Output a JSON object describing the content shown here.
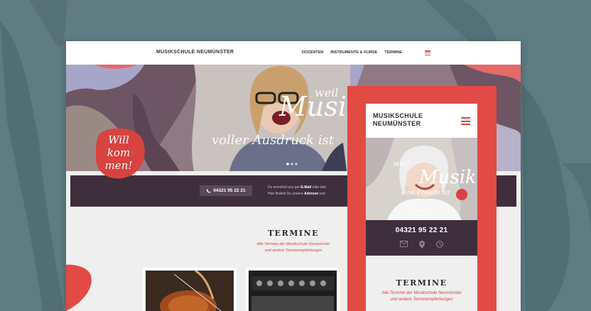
{
  "desktop": {
    "brand": "MUSIKSCHULE  NEUMÜNSTER",
    "menu": [
      "DOZENTEN",
      "INSTRUMENTE & KURSE",
      "TERMINE"
    ],
    "hero": {
      "welcome": [
        "Will",
        "kom",
        "men!"
      ],
      "slogan_small": "weil",
      "slogan_big": "Musik",
      "slogan_bottom": "voller Ausdruck ist"
    },
    "contact": {
      "phone": "04321 95 22 21",
      "line1_pre": "Du erreichst uns per",
      "line1_link": "E-Mail",
      "line1_post": "oder tele",
      "line2_pre": "Hier findest Du unsere",
      "line2_link": "Adresse",
      "line2_post": "und"
    },
    "termine": {
      "title": "TERMINE",
      "sub1": "Alle Termine der Musikschule Neumünster",
      "sub2": "und andere Terminempfehlungen"
    }
  },
  "mobile": {
    "brand_line1": "MUSIKSCHULE",
    "brand_line2": "NEUMÜNSTER",
    "hero": {
      "slogan_small": "weil",
      "slogan_big": "Musik",
      "slogan_bottom": "eine Freude ist"
    },
    "phone": "04321 95 22 21",
    "termine": {
      "title": "TERMINE",
      "sub1": "Alle Termine der Musikschule Neumünster",
      "sub2": "und andere Terminempfehlungen"
    }
  },
  "icons": [
    "menu-icon",
    "phone-icon",
    "mail-icon",
    "location-icon",
    "clock-icon"
  ],
  "colors": {
    "background": "#5e7c82",
    "accent": "#d84a4a",
    "dark_bar": "#3f2e3b",
    "mobile_frame": "#e14b44"
  }
}
